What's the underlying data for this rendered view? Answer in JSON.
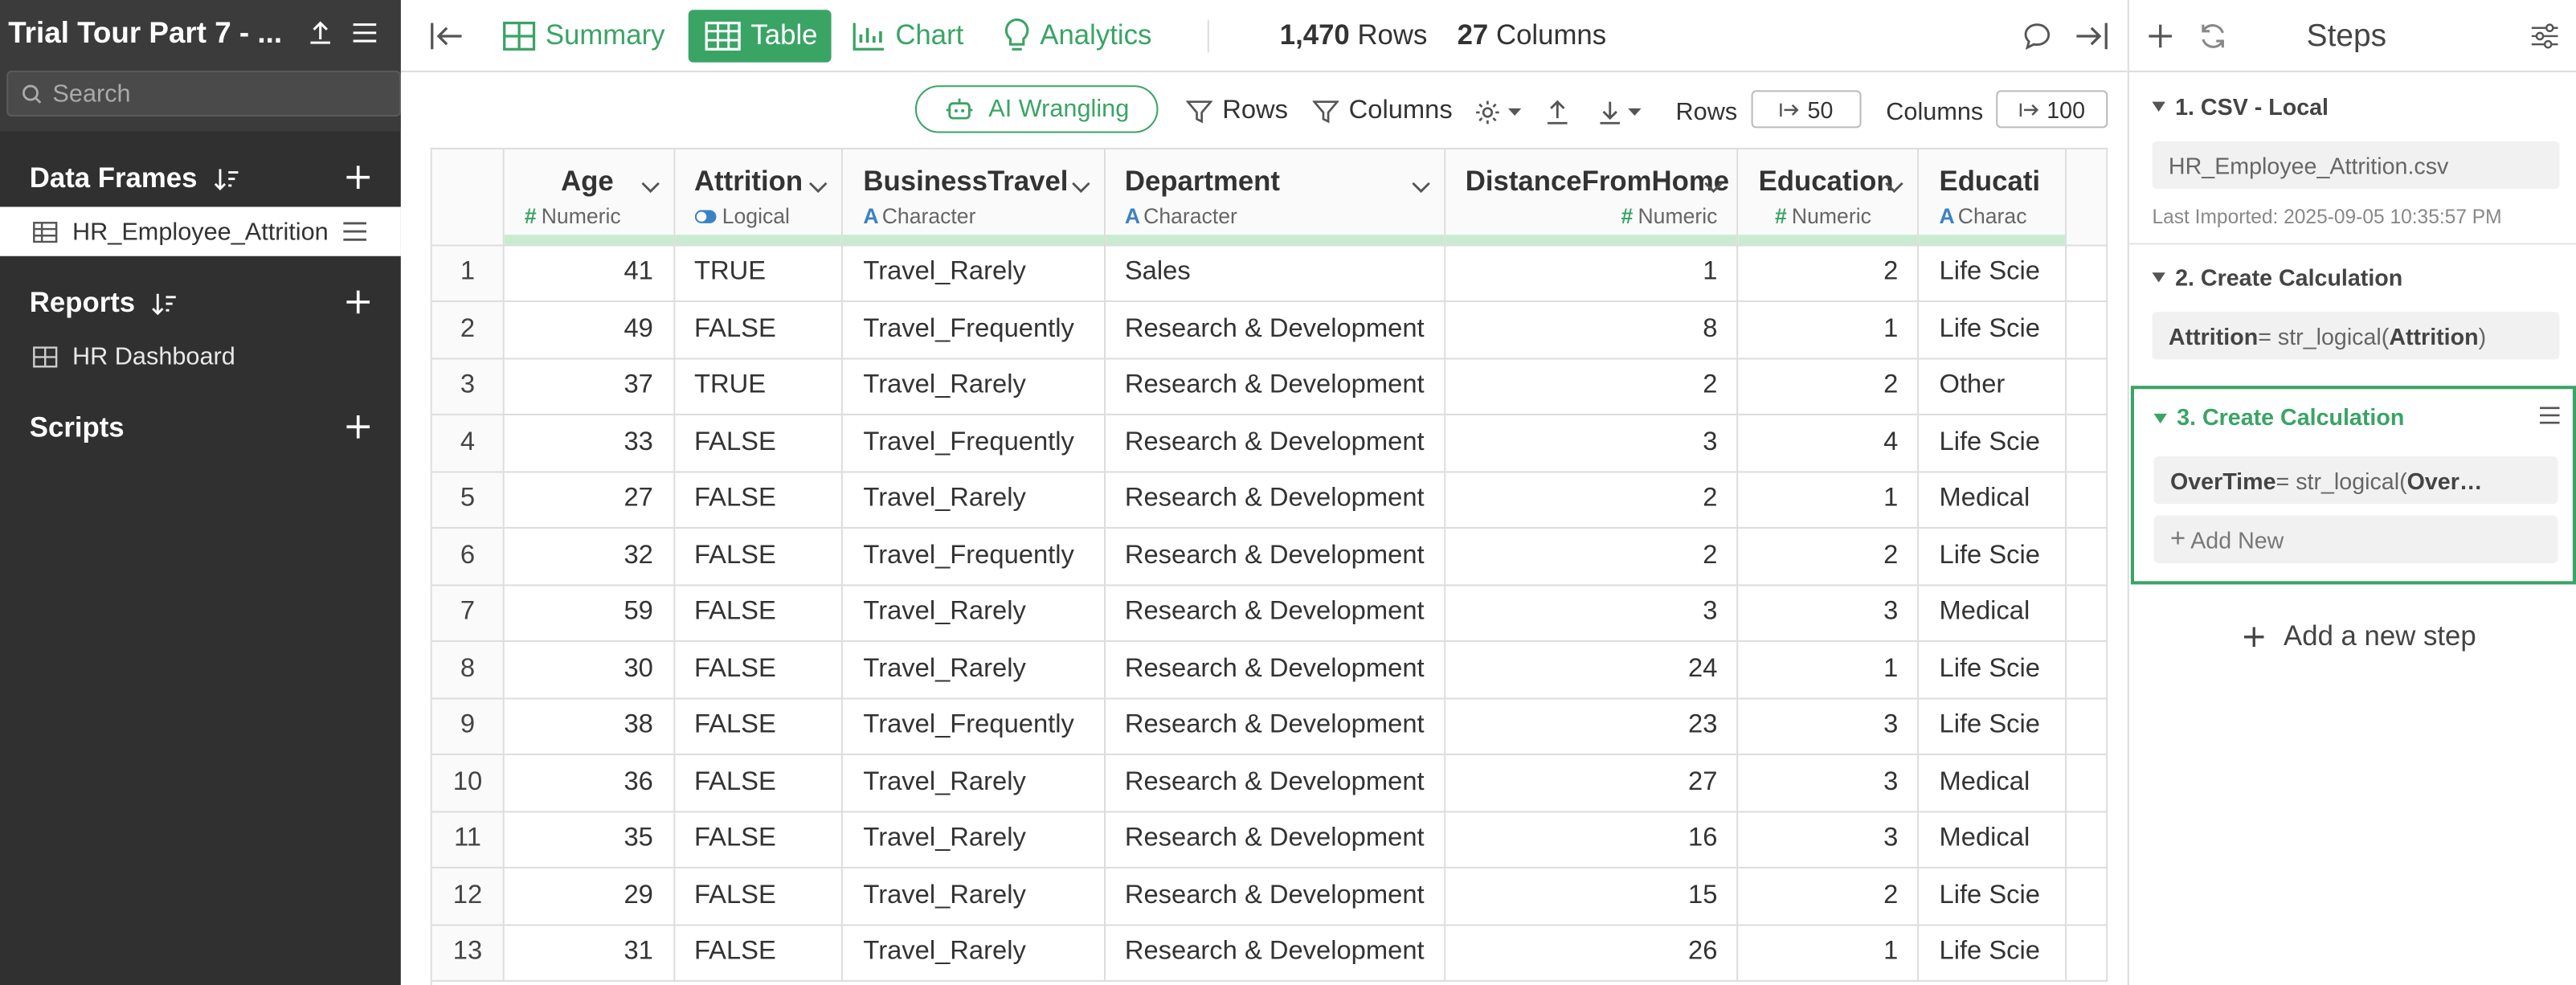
{
  "sidebar": {
    "title": "Trial Tour Part 7 - ...",
    "search_placeholder": "Search",
    "data_frames_label": "Data Frames",
    "data_frame_item": "HR_Employee_Attrition",
    "reports_label": "Reports",
    "report_item": "HR Dashboard",
    "scripts_label": "Scripts"
  },
  "topbar": {
    "tabs": [
      {
        "label": "Summary",
        "icon": "summary-icon",
        "active": false
      },
      {
        "label": "Table",
        "icon": "table-icon",
        "active": true
      },
      {
        "label": "Chart",
        "icon": "chart-icon",
        "active": false
      },
      {
        "label": "Analytics",
        "icon": "lightbulb-icon",
        "active": false
      }
    ],
    "rows_count": "1,470",
    "rows_label": "Rows",
    "cols_count": "27",
    "cols_label": "Columns"
  },
  "toolbar": {
    "ai_label": "AI Wrangling",
    "rows_filter": "Rows",
    "columns_filter": "Columns",
    "rows_label": "Rows",
    "rows_value": "50",
    "columns_label": "Columns",
    "columns_value": "100"
  },
  "table": {
    "columns": [
      {
        "name": "Age",
        "type": "Numeric"
      },
      {
        "name": "Attrition",
        "type": "Logical"
      },
      {
        "name": "BusinessTravel",
        "type": "Character"
      },
      {
        "name": "Department",
        "type": "Character"
      },
      {
        "name": "DistanceFromHome",
        "type": "Numeric"
      },
      {
        "name": "Education",
        "type": "Numeric"
      },
      {
        "name": "Educati",
        "type": "Charac"
      }
    ],
    "rows": [
      [
        "1",
        "41",
        "TRUE",
        "Travel_Rarely",
        "Sales",
        "1",
        "2",
        "Life Scie"
      ],
      [
        "2",
        "49",
        "FALSE",
        "Travel_Frequently",
        "Research & Development",
        "8",
        "1",
        "Life Scie"
      ],
      [
        "3",
        "37",
        "TRUE",
        "Travel_Rarely",
        "Research & Development",
        "2",
        "2",
        "Other"
      ],
      [
        "4",
        "33",
        "FALSE",
        "Travel_Frequently",
        "Research & Development",
        "3",
        "4",
        "Life Scie"
      ],
      [
        "5",
        "27",
        "FALSE",
        "Travel_Rarely",
        "Research & Development",
        "2",
        "1",
        "Medical"
      ],
      [
        "6",
        "32",
        "FALSE",
        "Travel_Frequently",
        "Research & Development",
        "2",
        "2",
        "Life Scie"
      ],
      [
        "7",
        "59",
        "FALSE",
        "Travel_Rarely",
        "Research & Development",
        "3",
        "3",
        "Medical"
      ],
      [
        "8",
        "30",
        "FALSE",
        "Travel_Rarely",
        "Research & Development",
        "24",
        "1",
        "Life Scie"
      ],
      [
        "9",
        "38",
        "FALSE",
        "Travel_Frequently",
        "Research & Development",
        "23",
        "3",
        "Life Scie"
      ],
      [
        "10",
        "36",
        "FALSE",
        "Travel_Rarely",
        "Research & Development",
        "27",
        "3",
        "Medical"
      ],
      [
        "11",
        "35",
        "FALSE",
        "Travel_Rarely",
        "Research & Development",
        "16",
        "3",
        "Medical"
      ],
      [
        "12",
        "29",
        "FALSE",
        "Travel_Rarely",
        "Research & Development",
        "15",
        "2",
        "Life Scie"
      ],
      [
        "13",
        "31",
        "FALSE",
        "Travel_Rarely",
        "Research & Development",
        "26",
        "1",
        "Life Scie"
      ]
    ]
  },
  "steps": {
    "title": "Steps",
    "step1": {
      "title": "1. CSV - Local",
      "file": "HR_Employee_Attrition.csv",
      "imported": "Last Imported: 2025-09-05 10:35:57 PM"
    },
    "step2": {
      "title": "2. Create Calculation",
      "bold": "Attrition",
      "expr": " = str_logical(",
      "arg": "Attrition",
      "close": ")"
    },
    "step3": {
      "title": "3. Create Calculation",
      "bold": "OverTime",
      "expr": " = str_logical(",
      "arg": "Over…",
      "add_new": "Add New"
    },
    "add_step": "Add a new step"
  },
  "colors": {
    "accent": "#3aa465",
    "sidebar_bg": "#303030",
    "logical_icon": "#3b82c4",
    "character_icon": "#3b82c4"
  }
}
